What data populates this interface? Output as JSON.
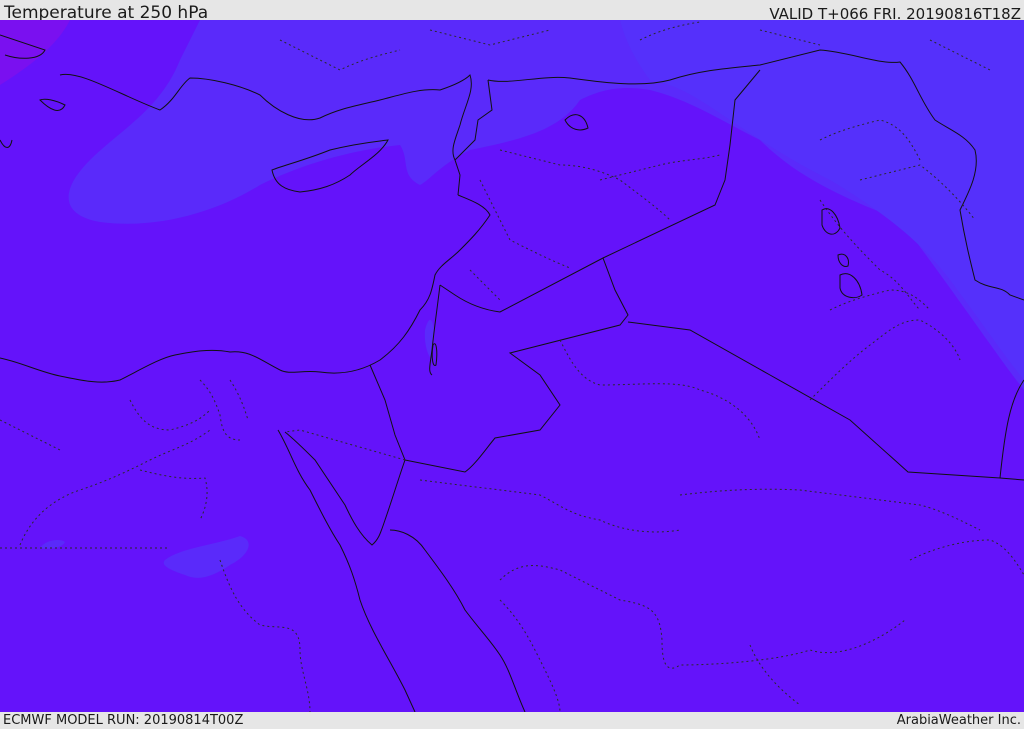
{
  "header": {
    "title": "Temperature at 250 hPa",
    "valid": "VALID T+066 FRI. 20190816T18Z"
  },
  "footer": {
    "model_run": "ECMWF MODEL RUN: 20190814T00Z",
    "credit": "ArabiaWeather Inc."
  },
  "map": {
    "colors": {
      "base_fill": "#6413fa",
      "cool_band": "#5a2afa",
      "coolest_band": "#5530fb",
      "magenta_corner": "#7a10f0",
      "border_line": "#111111",
      "admin_line": "#2a2a2a"
    }
  }
}
